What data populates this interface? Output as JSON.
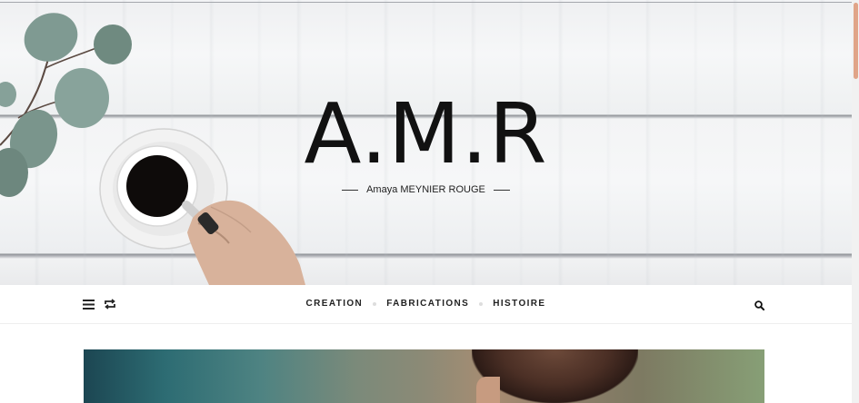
{
  "header": {
    "site_title": "A.M.R",
    "tagline": "Amaya MEYNIER ROUGE"
  },
  "nav": {
    "menu_items": [
      "CREATION",
      "FABRICATIONS",
      "HISTOIRE"
    ],
    "left_icons": [
      "hamburger-menu-icon",
      "random-post-icon"
    ],
    "right_icons": [
      "search-icon"
    ]
  },
  "colors": {
    "scrollbar_thumb": "#e0a488",
    "text": "#222222",
    "separator_dot": "#dddddd"
  }
}
